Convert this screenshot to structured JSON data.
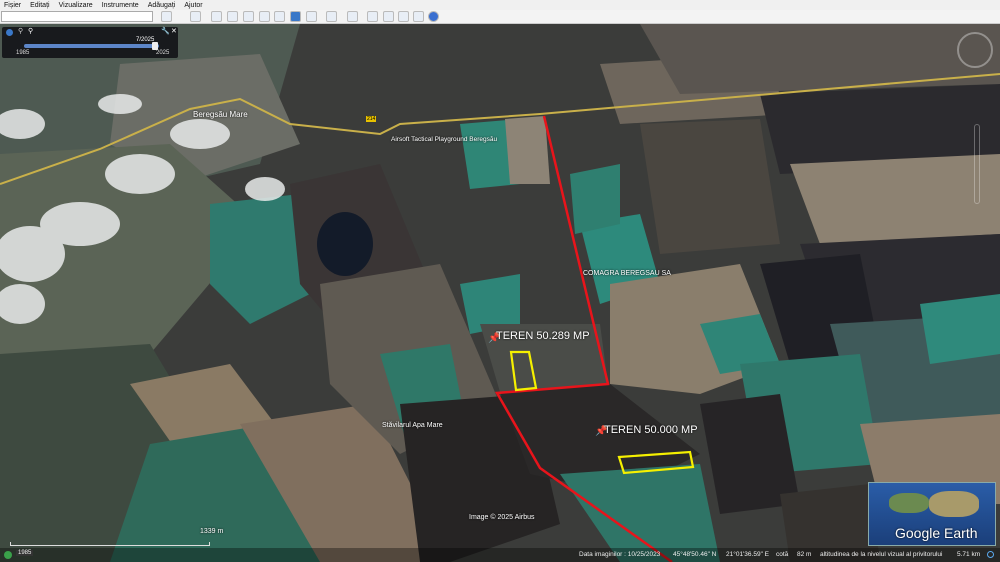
{
  "menu": [
    "Fișier",
    "Editați",
    "Vizualizare",
    "Instrumente",
    "Adăugați",
    "Ajutor"
  ],
  "search": {
    "value": "",
    "placeholder": ""
  },
  "time_slider": {
    "current": "7/2025",
    "start": "1985",
    "end": "2025",
    "position": 0.97
  },
  "map_labels": {
    "town": "Beregsău Mare",
    "airsoft": "Airsoft Tactical Playground Beregsău",
    "comagra": "COMAGRA BEREGSAU SA",
    "stavilar": "Stăvilarul Apa Mare",
    "road": "214"
  },
  "placemarks": [
    {
      "label": "TEREN 50.289 MP"
    },
    {
      "label": "TEREN 50.000 MP"
    }
  ],
  "scale": {
    "label": "1339 m"
  },
  "copyright": "Image © 2025 Airbus",
  "historical_year": "1985",
  "brand": "Google Earth",
  "status": {
    "image_date": "Data imaginilor : 10/25/2023",
    "lat": "45°48'50.46\" N",
    "lon": "21°01'36.59\" E",
    "elev_label": "cotă",
    "elev": "82 m",
    "eye_label": "altitudinea de la nivelul vizual al privitorului",
    "eye_alt": "5.71 km"
  },
  "colors": {
    "boundary": "#e8141b",
    "parcel": "#f5f000"
  }
}
